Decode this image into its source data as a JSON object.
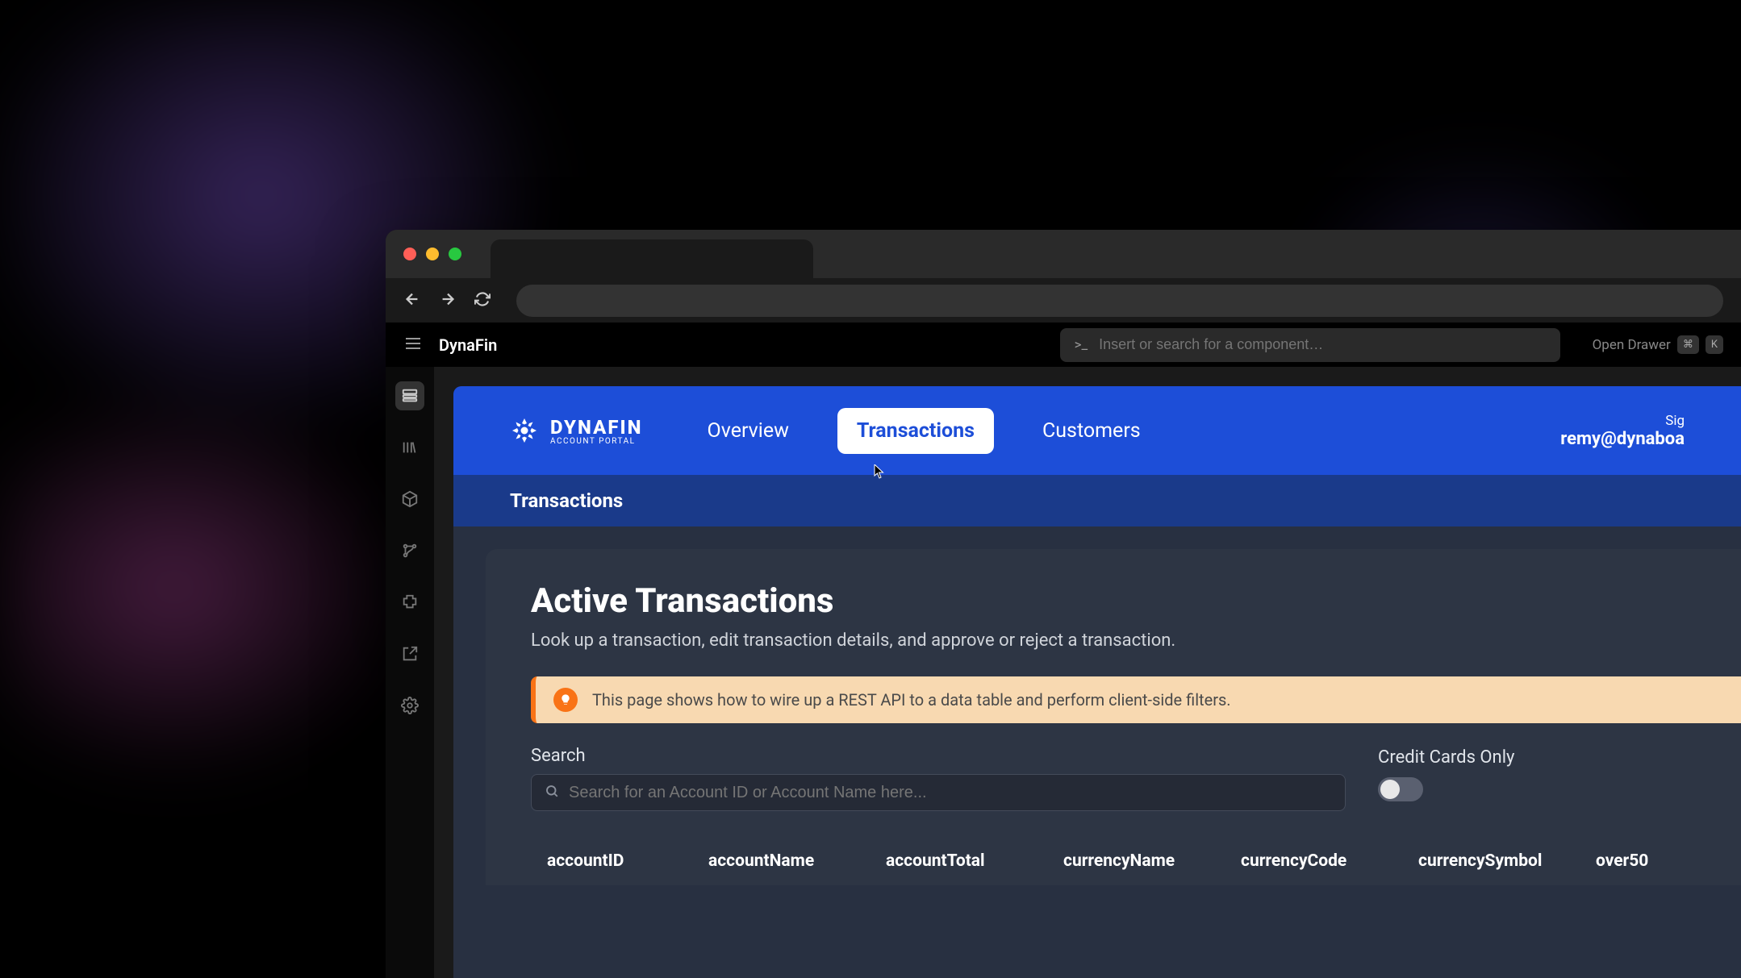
{
  "app": {
    "title": "DynaFin",
    "search_placeholder": "Insert or search for a component…",
    "drawer_hint": "Open Drawer",
    "kbd_cmd": "⌘",
    "kbd_k": "K"
  },
  "portal": {
    "logo_main": "DYNAFIN",
    "logo_sub": "ACCOUNT PORTAL",
    "tabs": [
      {
        "label": "Overview",
        "active": false
      },
      {
        "label": "Transactions",
        "active": true
      },
      {
        "label": "Customers",
        "active": false
      }
    ],
    "user_top": "Sig",
    "user_email": "remy@dynaboa",
    "subheader": "Transactions"
  },
  "panel": {
    "title": "Active Transactions",
    "subtitle": "Look up a transaction, edit transaction details, and approve or reject a transaction.",
    "info": "This page shows how to wire up a REST API to a data table and perform client-side filters.",
    "search_label": "Search",
    "search_placeholder": "Search for an Account ID or Account Name here...",
    "toggle_label": "Credit Cards Only",
    "columns": [
      "accountID",
      "accountName",
      "accountTotal",
      "currencyName",
      "currencyCode",
      "currencySymbol",
      "over50"
    ]
  }
}
